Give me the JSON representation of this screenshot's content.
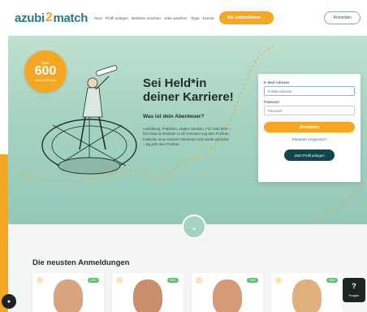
{
  "header": {
    "logo": {
      "part1": "azubi",
      "mark": "2",
      "part2": "match"
    },
    "nav": [
      "Neu!",
      "Profil anlegen",
      "Betriebe ansehen",
      "Jobs ansehen",
      "Tipps",
      "Events"
    ],
    "register_button": "Als Unternehmen →",
    "login_button": "Anmelden"
  },
  "hero": {
    "badge": {
      "pre": "Über",
      "number": "600",
      "post": "Azubis/ Studis"
    },
    "title_line1": "Sei Held*in",
    "title_line2": "deiner Karriere!",
    "subtitle": "Was ist dein Abenteuer?",
    "text": "Ausbildung, Praktikum, duales Studium, FSJ oder BFD – hier lässt du Betriebe zu dir kommen! Leg dein Profil an, entdecke neue Karriere-Abenteuer und werde gefunden – leg jetzt dein Profil an.",
    "scroll_icon": "chevron-down-icon"
  },
  "login": {
    "email_label": "E-Mail-Adresse",
    "email_placeholder": "E-Mail-Adresse",
    "password_label": "Passwort",
    "password_placeholder": "Passwort",
    "submit": "Anmelden",
    "forgot": "Passwort vergessen?",
    "create_profile": "Jetzt Profil anlegen"
  },
  "registrations": {
    "title": "Die neusten Anmeldungen",
    "cards": [
      {
        "badge": "NEU",
        "skin": "#d8a47e"
      },
      {
        "badge": "NEU",
        "skin": "#c98f6a"
      },
      {
        "badge": "NEU",
        "skin": "#d39b78"
      },
      {
        "badge": "NEU",
        "skin": "#e0b07f"
      }
    ]
  },
  "help": {
    "icon": "?",
    "label": "Fragen"
  },
  "chat_icon": "chat-icon",
  "colors": {
    "accent": "#f5a623",
    "brand": "#2b7a83",
    "dark": "#12464a",
    "hero": "#a5d3c0"
  }
}
